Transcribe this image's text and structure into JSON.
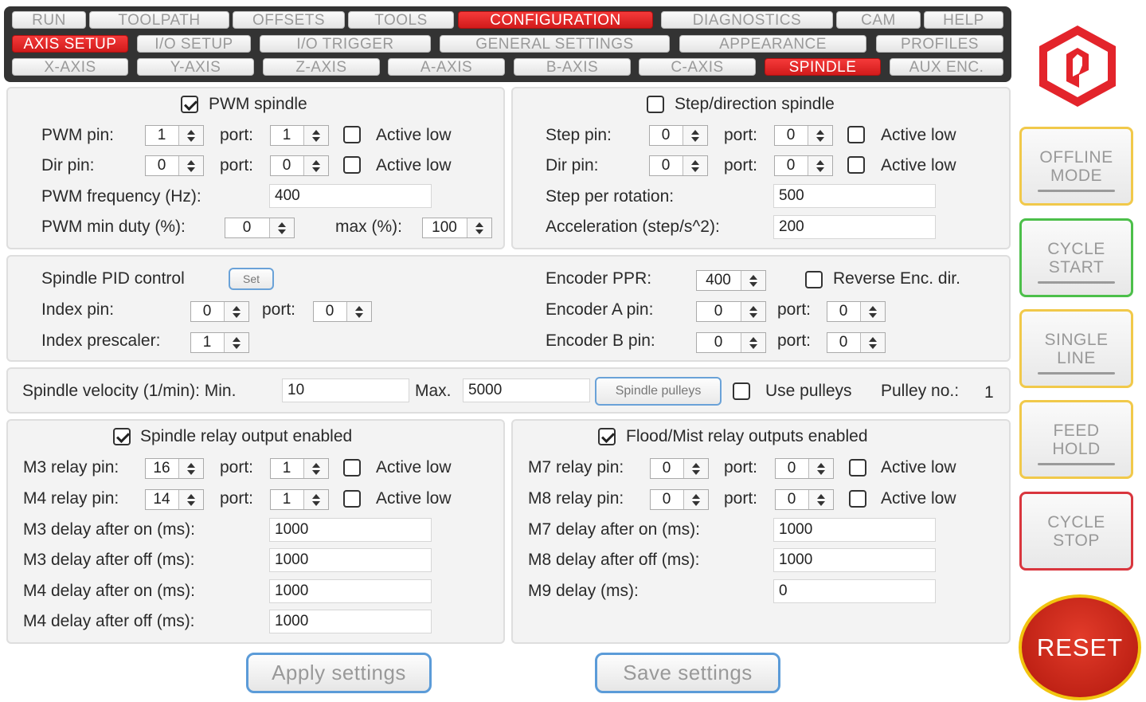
{
  "nav": {
    "row1": [
      {
        "label": "RUN",
        "active": false
      },
      {
        "label": "TOOLPATH",
        "active": false
      },
      {
        "label": "OFFSETS",
        "active": false
      },
      {
        "label": "TOOLS",
        "active": false
      },
      {
        "label": "CONFIGURATION",
        "active": true
      },
      {
        "label": "DIAGNOSTICS",
        "active": false
      },
      {
        "label": "CAM",
        "active": false
      },
      {
        "label": "HELP",
        "active": false
      }
    ],
    "row2": [
      {
        "label": "AXIS SETUP",
        "active": true
      },
      {
        "label": "I/O SETUP",
        "active": false
      },
      {
        "label": "I/O TRIGGER",
        "active": false
      },
      {
        "label": "GENERAL SETTINGS",
        "active": false
      },
      {
        "label": "APPEARANCE",
        "active": false
      },
      {
        "label": "PROFILES",
        "active": false
      }
    ],
    "row3": [
      {
        "label": "X-AXIS",
        "active": false
      },
      {
        "label": "Y-AXIS",
        "active": false
      },
      {
        "label": "Z-AXIS",
        "active": false
      },
      {
        "label": "A-AXIS",
        "active": false
      },
      {
        "label": "B-AXIS",
        "active": false
      },
      {
        "label": "C-AXIS",
        "active": false
      },
      {
        "label": "SPINDLE",
        "active": true
      },
      {
        "label": "AUX ENC.",
        "active": false
      }
    ]
  },
  "pwm": {
    "title": "PWM spindle",
    "enabled": true,
    "pwm_pin_label": "PWM pin:",
    "pwm_pin": "1",
    "port_label": "port:",
    "pwm_port": "1",
    "active_low_label": "Active low",
    "dir_pin_label": "Dir pin:",
    "dir_pin": "0",
    "dir_port": "0",
    "freq_label": "PWM frequency (Hz):",
    "freq": "400",
    "min_duty_label": "PWM min duty (%):",
    "min_duty": "0",
    "max_label": "max (%):",
    "max_duty": "100"
  },
  "step": {
    "title": "Step/direction spindle",
    "enabled": false,
    "step_pin_label": "Step pin:",
    "step_pin": "0",
    "port_label": "port:",
    "step_port": "0",
    "active_low_label": "Active low",
    "dir_pin_label": "Dir pin:",
    "dir_pin": "0",
    "dir_port": "0",
    "spr_label": "Step per rotation:",
    "spr": "500",
    "accel_label": "Acceleration (step/s^2):",
    "accel": "200"
  },
  "pid": {
    "title": "Spindle PID control",
    "set_label": "Set",
    "index_pin_label": "Index pin:",
    "index_pin": "0",
    "port_label": "port:",
    "index_port": "0",
    "prescaler_label": "Index prescaler:",
    "prescaler": "1",
    "ppr_label": "Encoder PPR:",
    "ppr": "400",
    "reverse_label": "Reverse Enc. dir.",
    "enc_a_label": "Encoder A pin:",
    "enc_a_pin": "0",
    "enc_a_port": "0",
    "enc_b_label": "Encoder B pin:",
    "enc_b_pin": "0",
    "enc_b_port": "0"
  },
  "velocity": {
    "label": "Spindle velocity (1/min): Min.",
    "min": "10",
    "max_label": "Max.",
    "max": "5000",
    "pulleys_button": "Spindle pulleys",
    "use_pulleys_label": "Use pulleys",
    "pulley_no_label": "Pulley no.:",
    "pulley_no": "1"
  },
  "relay": {
    "title": "Spindle relay output enabled",
    "enabled": true,
    "m3_pin_label": "M3 relay pin:",
    "m3_pin": "16",
    "port_label": "port:",
    "m3_port": "1",
    "active_low_label": "Active low",
    "m4_pin_label": "M4 relay pin:",
    "m4_pin": "14",
    "m4_port": "1",
    "m3_on_label": "M3 delay after on (ms):",
    "m3_on": "1000",
    "m3_off_label": "M3 delay after off (ms):",
    "m3_off": "1000",
    "m4_on_label": "M4 delay after on (ms):",
    "m4_on": "1000",
    "m4_off_label": "M4 delay after off (ms):",
    "m4_off": "1000"
  },
  "flood": {
    "title": "Flood/Mist relay outputs enabled",
    "enabled": true,
    "m7_pin_label": "M7 relay pin:",
    "m7_pin": "0",
    "port_label": "port:",
    "m7_port": "0",
    "active_low_label": "Active low",
    "m8_pin_label": "M8 relay pin:",
    "m8_pin": "0",
    "m8_port": "0",
    "m7_on_label": "M7 delay after on (ms):",
    "m7_on": "1000",
    "m8_off_label": "M8 delay after off (ms):",
    "m8_off": "1000",
    "m9_label": "M9 delay (ms):",
    "m9": "0"
  },
  "actions": {
    "apply": "Apply settings",
    "save": "Save settings"
  },
  "side": {
    "offline": "OFFLINE\nMODE",
    "cycle_start": "CYCLE\nSTART",
    "single_line": "SINGLE\nLINE",
    "feed_hold": "FEED\nHOLD",
    "cycle_stop": "CYCLE\nSTOP",
    "reset": "RESET"
  },
  "colors": {
    "accent": "#e3242b",
    "offline": "#f1c94a",
    "start": "#4cbf4a",
    "single": "#f1c94a",
    "hold": "#f1c94a",
    "stop": "#d9363e"
  }
}
